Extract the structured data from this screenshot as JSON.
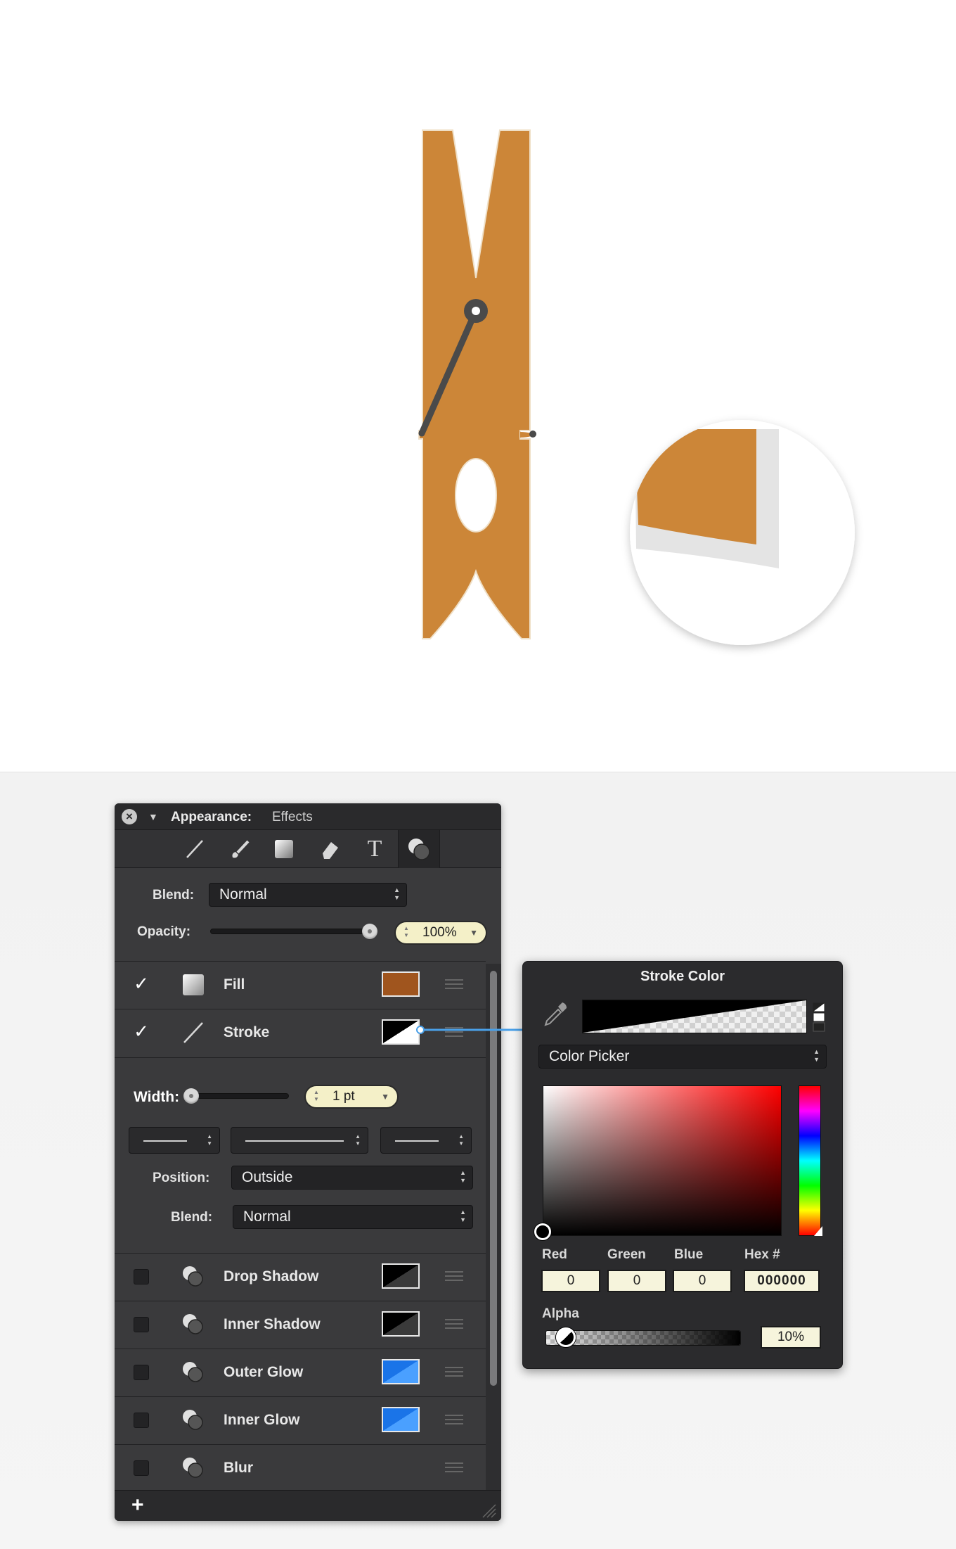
{
  "appearance_panel": {
    "title": "Appearance:",
    "subtitle": "Effects",
    "tools": [
      "stroke-tool-icon",
      "brush-tool-icon",
      "fill-tool-icon",
      "eraser-tool-icon",
      "text-tool-icon",
      "effects-tool-icon"
    ],
    "blend_label": "Blend:",
    "blend_value": "Normal",
    "opacity_label": "Opacity:",
    "opacity_value": "100%",
    "opacity_level": 1.0,
    "layers": [
      {
        "name": "Fill",
        "checked": true,
        "checkmark": "✓",
        "color": "#a0551e"
      },
      {
        "name": "Stroke",
        "checked": true,
        "checkmark": "✓",
        "color": "#000000"
      }
    ],
    "stroke_options": {
      "width_label": "Width:",
      "width_value": "1 pt",
      "position_label": "Position:",
      "position_value": "Outside",
      "blend_label": "Blend:",
      "blend_value": "Normal"
    },
    "effects": [
      {
        "name": "Drop Shadow",
        "checked": false,
        "color": "#000000"
      },
      {
        "name": "Inner Shadow",
        "checked": false,
        "color": "#000000"
      },
      {
        "name": "Outer Glow",
        "checked": false,
        "color": "#1a74e8"
      },
      {
        "name": "Inner Glow",
        "checked": false,
        "color": "#1a74e8"
      },
      {
        "name": "Blur",
        "checked": false
      }
    ],
    "add_label": "+"
  },
  "stroke_color_popover": {
    "title": "Stroke Color",
    "mode": "Color Picker",
    "red_label": "Red",
    "red_value": "0",
    "green_label": "Green",
    "green_value": "0",
    "blue_label": "Blue",
    "blue_value": "0",
    "hex_label": "Hex #",
    "hex_value": "000000",
    "alpha_label": "Alpha",
    "alpha_value": "10%",
    "alpha_level": 0.1
  },
  "artwork": {
    "clothespin_color": "#cc8638",
    "spring_color": "#4a4a4a",
    "stroke_preview_color": "#e4e4e4"
  }
}
